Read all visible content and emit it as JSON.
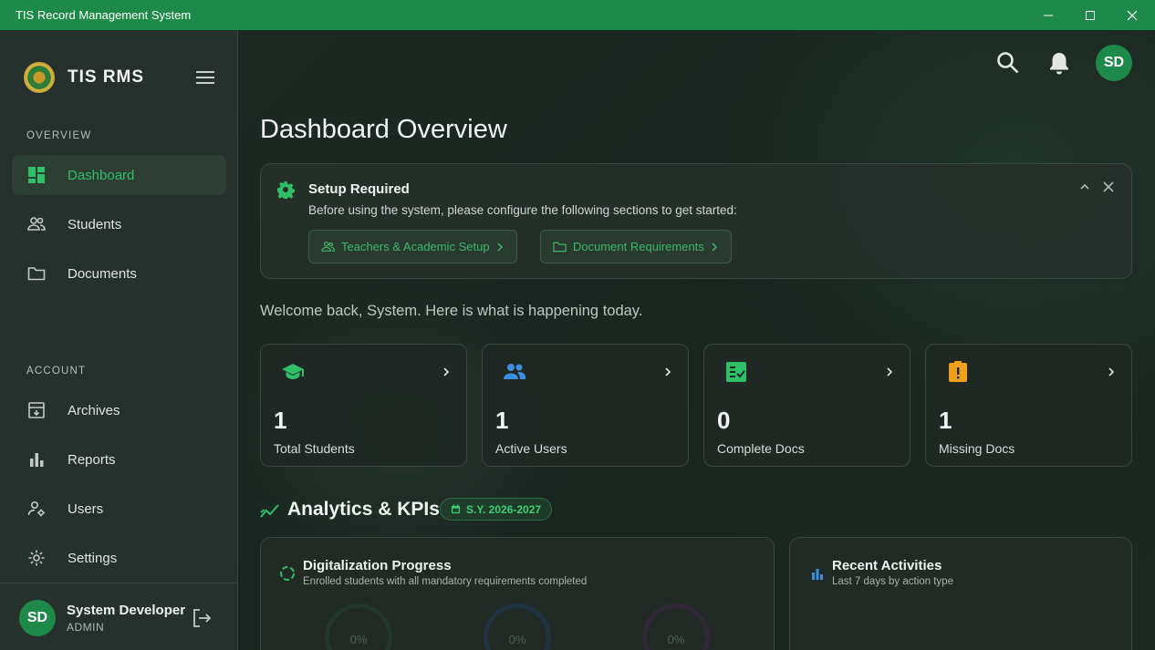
{
  "window": {
    "title": "TIS Record Management System"
  },
  "sidebar": {
    "brand": "TIS RMS",
    "overview_label": "OVERVIEW",
    "account_label": "ACCOUNT",
    "nav": [
      {
        "label": "Dashboard",
        "icon": "dashboard-icon",
        "active": true
      },
      {
        "label": "Students",
        "icon": "people-icon"
      },
      {
        "label": "Documents",
        "icon": "folder-icon"
      }
    ],
    "account": [
      {
        "label": "Archives",
        "icon": "archive-icon"
      },
      {
        "label": "Reports",
        "icon": "bar-chart-icon"
      },
      {
        "label": "Users",
        "icon": "user-gear-icon"
      },
      {
        "label": "Settings",
        "icon": "gear-icon"
      }
    ],
    "user": {
      "initials": "SD",
      "name": "System Developer",
      "role": "ADMIN"
    }
  },
  "header": {
    "avatar_initials": "SD"
  },
  "main": {
    "title": "Dashboard Overview",
    "setup": {
      "title": "Setup Required",
      "description": "Before using the system, please configure the following sections to get started:",
      "actions": [
        "Teachers & Academic Setup",
        "Document Requirements"
      ]
    },
    "welcome": "Welcome back, System. Here is what is happening today.",
    "stats": [
      {
        "value": "1",
        "label": "Total Students",
        "icon": "graduation-cap-icon",
        "color": "#2fbf66"
      },
      {
        "value": "1",
        "label": "Active Users",
        "icon": "users-icon",
        "color": "#3b8fe0"
      },
      {
        "value": "0",
        "label": "Complete Docs",
        "icon": "checklist-icon",
        "color": "#2fbf66"
      },
      {
        "value": "1",
        "label": "Missing Docs",
        "icon": "alert-clipboard-icon",
        "color": "#f0a01c"
      }
    ],
    "analytics": {
      "title": "Analytics & KPIs",
      "school_year": "S.Y. 2026-2027",
      "digitalization": {
        "title": "Digitalization Progress",
        "subtitle": "Enrolled students with all mandatory requirements completed",
        "rings": [
          "0%",
          "0%",
          "0%"
        ]
      },
      "recent": {
        "title": "Recent Activities",
        "subtitle": "Last 7 days by action type"
      }
    }
  },
  "colors": {
    "accent": "#1e8a4a",
    "accent_text": "#2fbf66",
    "warning": "#f0a01c",
    "info": "#3b8fe0"
  }
}
